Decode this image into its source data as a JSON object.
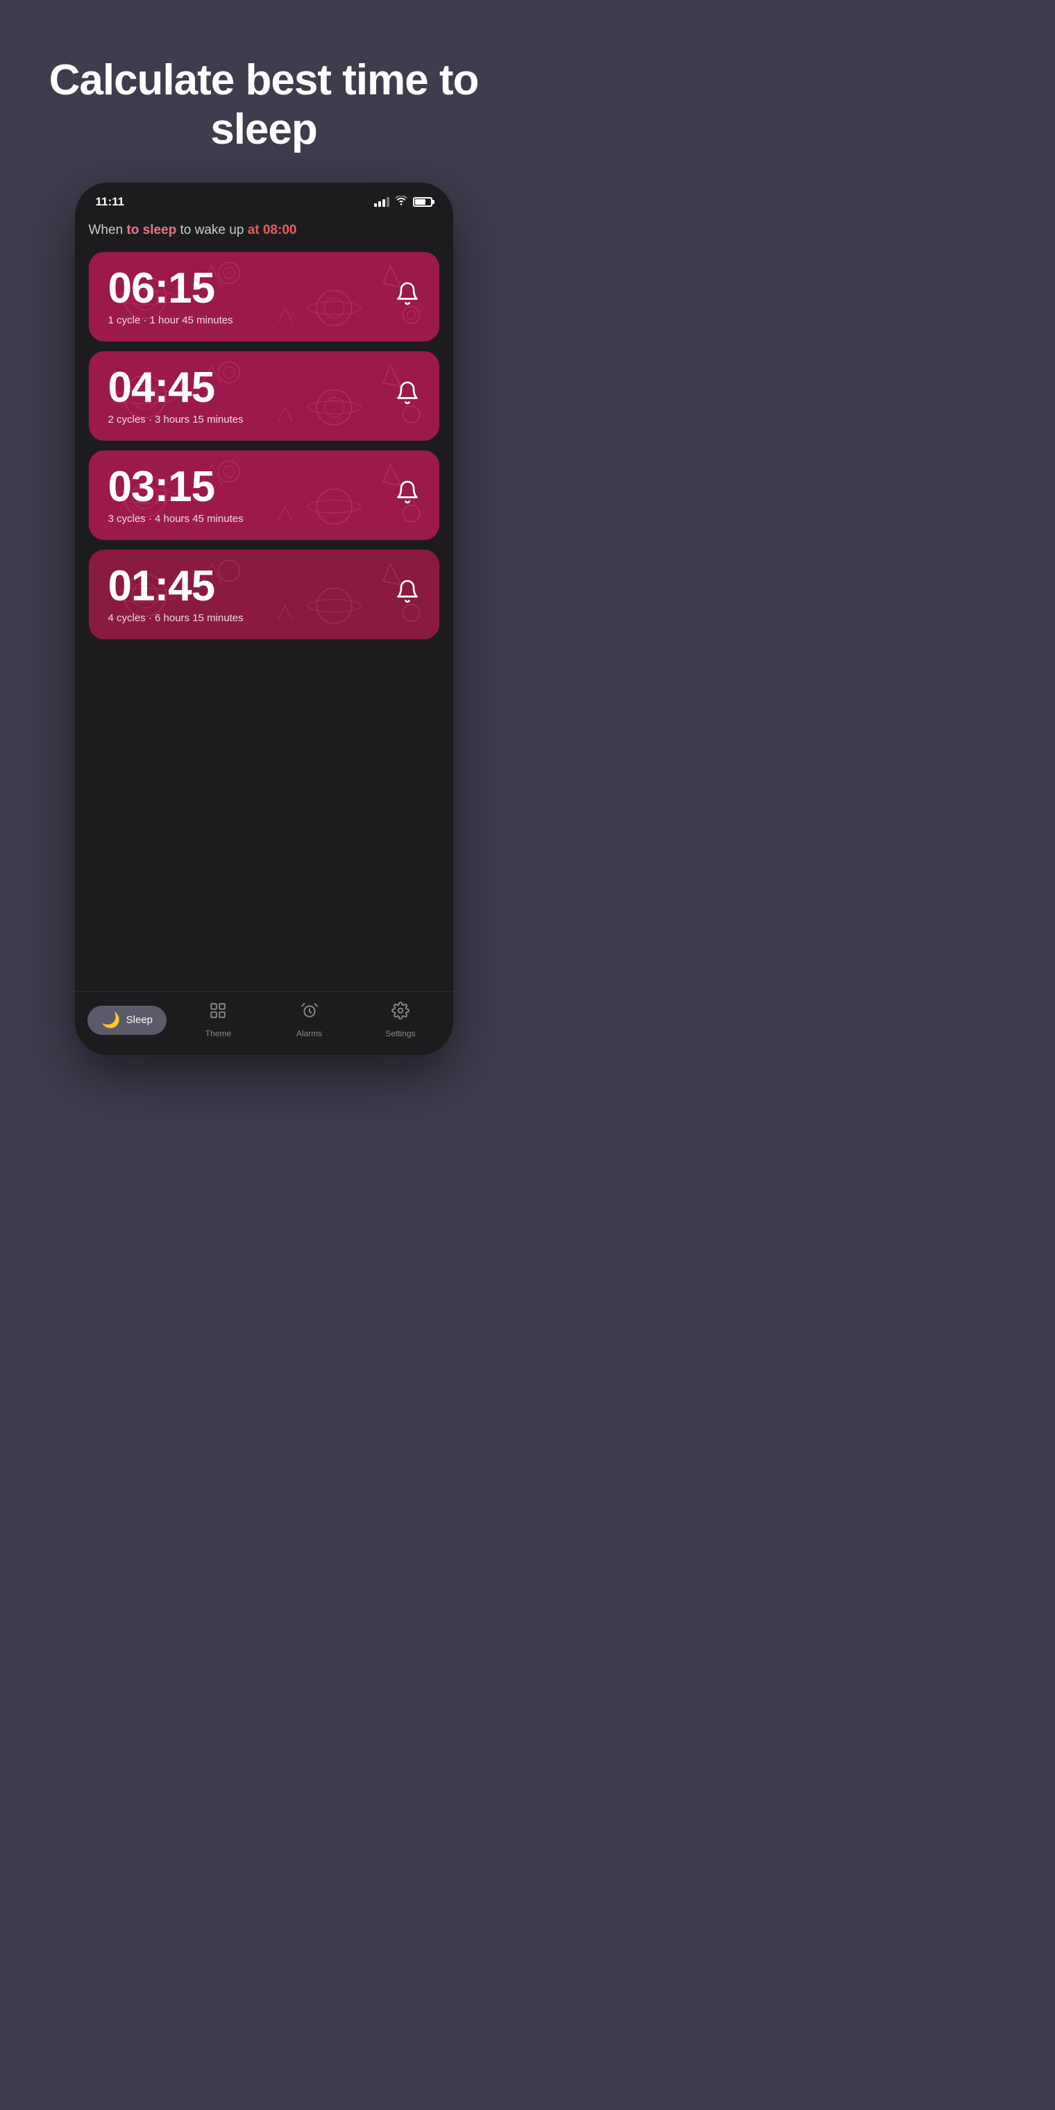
{
  "headline": "Calculate best time to sleep",
  "status_bar": {
    "time": "11:11"
  },
  "subtitle": {
    "prefix": "When ",
    "highlight1": "to sleep",
    "middle": " to wake up ",
    "highlight2": "at 08:00"
  },
  "cards": [
    {
      "time": "06:15",
      "desc": "1 cycle · 1 hour 45 minutes"
    },
    {
      "time": "04:45",
      "desc": "2 cycles · 3 hours 15 minutes"
    },
    {
      "time": "03:15",
      "desc": "3 cycles · 4 hours 45 minutes"
    },
    {
      "time": "01:45",
      "desc": "4 cycles · 6 hours 15 minutes"
    }
  ],
  "nav": {
    "items": [
      {
        "label": "Sleep",
        "icon": "moon",
        "active": true
      },
      {
        "label": "Theme",
        "icon": "theme",
        "active": false
      },
      {
        "label": "Alarms",
        "icon": "alarm",
        "active": false
      },
      {
        "label": "Settings",
        "icon": "settings",
        "active": false
      }
    ]
  }
}
